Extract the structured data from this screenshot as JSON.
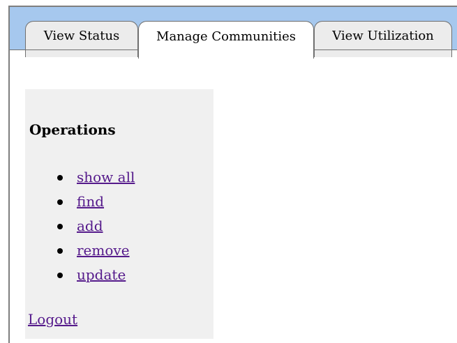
{
  "tabs": [
    {
      "label": "View Status",
      "active": false
    },
    {
      "label": "Manage Communities",
      "active": true
    },
    {
      "label": "View Utilization",
      "active": false
    }
  ],
  "sidebar": {
    "heading": "Operations",
    "items": [
      {
        "label": "show all"
      },
      {
        "label": "find"
      },
      {
        "label": "add"
      },
      {
        "label": "remove"
      },
      {
        "label": "update"
      }
    ],
    "logout_label": "Logout"
  },
  "colors": {
    "tabbar_bg": "#a6c8ee",
    "sidebar_bg": "#f0f0f0",
    "link": "#551a8b"
  }
}
